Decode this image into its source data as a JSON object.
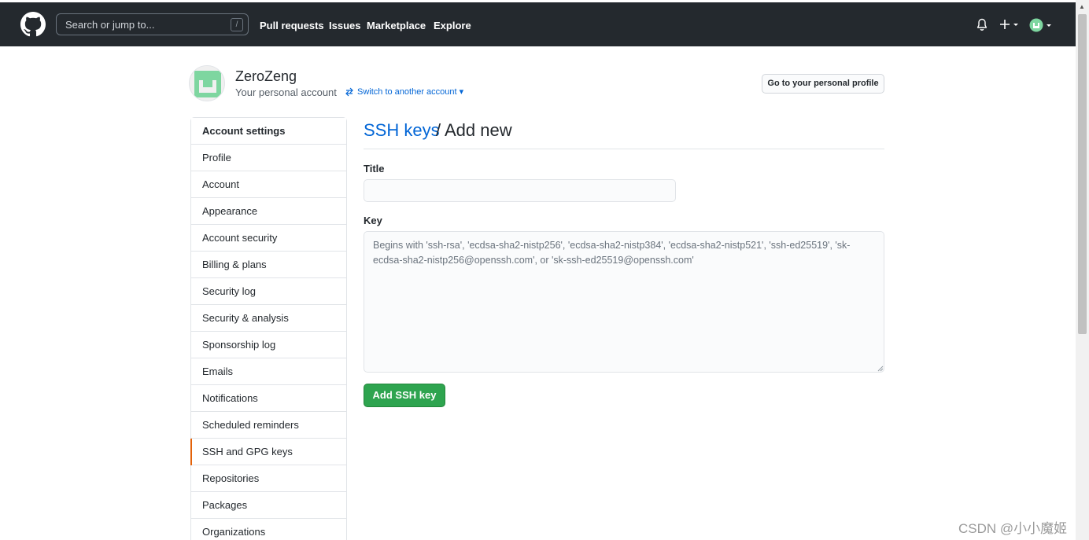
{
  "header": {
    "search_placeholder": "Search or jump to...",
    "search_shortcut": "/",
    "nav": [
      "Pull requests",
      "Issues",
      "Marketplace",
      "Explore"
    ]
  },
  "account": {
    "name": "ZeroZeng",
    "subtitle": "Your personal account",
    "switch_label": "Switch to another account",
    "profile_button": "Go to your personal profile"
  },
  "sidebar": {
    "heading": "Account settings",
    "items": [
      {
        "label": "Profile"
      },
      {
        "label": "Account"
      },
      {
        "label": "Appearance"
      },
      {
        "label": "Account security"
      },
      {
        "label": "Billing & plans"
      },
      {
        "label": "Security log"
      },
      {
        "label": "Security & analysis"
      },
      {
        "label": "Sponsorship log"
      },
      {
        "label": "Emails"
      },
      {
        "label": "Notifications"
      },
      {
        "label": "Scheduled reminders"
      },
      {
        "label": "SSH and GPG keys",
        "selected": true
      },
      {
        "label": "Repositories"
      },
      {
        "label": "Packages"
      },
      {
        "label": "Organizations"
      }
    ]
  },
  "main": {
    "breadcrumb_link": "SSH keys",
    "breadcrumb_rest": "/ Add new",
    "title_label": "Title",
    "title_value": "",
    "key_label": "Key",
    "key_placeholder": "Begins with 'ssh-rsa', 'ecdsa-sha2-nistp256', 'ecdsa-sha2-nistp384', 'ecdsa-sha2-nistp521', 'ssh-ed25519', 'sk-ecdsa-sha2-nistp256@openssh.com', or 'sk-ssh-ed25519@openssh.com'",
    "submit_label": "Add SSH key"
  },
  "watermark": "CSDN @小小魔姬",
  "colors": {
    "header_bg": "#24292e",
    "link": "#0366d6",
    "primary_button": "#2ea44f",
    "selected_indicator": "#e36209",
    "avatar_green": "#7ed6a0"
  },
  "icons": {
    "logo": "github-octocat-icon",
    "notifications": "bell-icon",
    "create": "plus-icon",
    "switch": "arrows-switch-icon"
  }
}
